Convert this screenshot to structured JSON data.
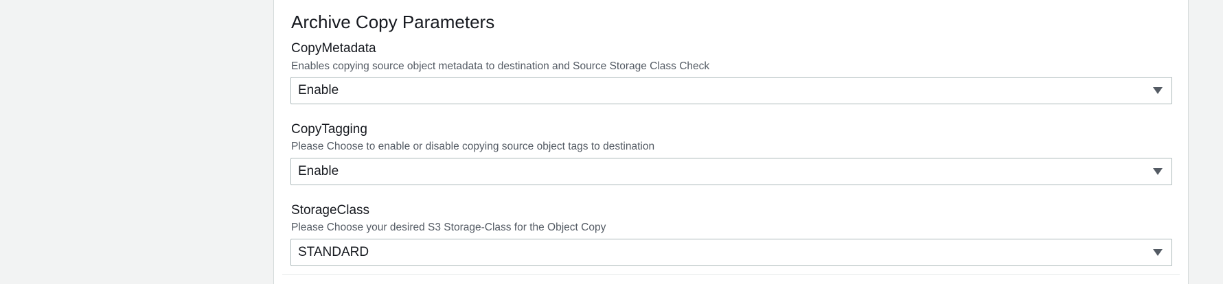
{
  "section": {
    "title": "Archive Copy Parameters"
  },
  "fields": [
    {
      "label": "CopyMetadata",
      "description": "Enables copying source object metadata to destination and Source Storage Class Check",
      "value": "Enable",
      "icon": "caret-down-icon"
    },
    {
      "label": "CopyTagging",
      "description": "Please Choose to enable or disable copying source object tags to destination",
      "value": "Enable",
      "icon": "caret-down-icon"
    },
    {
      "label": "StorageClass",
      "description": "Please Choose your desired S3 Storage-Class for the Object Copy",
      "value": "STANDARD",
      "icon": "caret-down-icon"
    }
  ],
  "colors": {
    "page_background": "#f2f3f3",
    "panel_background": "#ffffff",
    "text": "#16191f",
    "secondary_text": "#545b64",
    "border": "#aab7b8"
  }
}
